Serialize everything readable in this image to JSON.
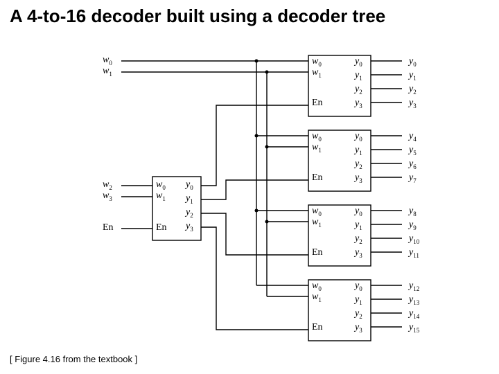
{
  "title": "A 4-to-16 decoder built using a decoder tree",
  "caption": "[ Figure 4.16 from the textbook ]",
  "ext_in_top1": "w",
  "ext_in_top1_sub": "0",
  "ext_in_top2": "w",
  "ext_in_top2_sub": "1",
  "ext_in_bot1": "w",
  "ext_in_bot1_sub": "2",
  "ext_in_bot2": "w",
  "ext_in_bot2_sub": "3",
  "ext_en": "En",
  "left_dec": {
    "w0": "w",
    "w0s": "0",
    "w1": "w",
    "w1s": "1",
    "en": "En",
    "y0": "y",
    "y0s": "0",
    "y1": "y",
    "y1s": "1",
    "y2": "y",
    "y2s": "2",
    "y3": "y",
    "y3s": "3"
  },
  "right_decs": [
    {
      "w0": "w",
      "w0s": "0",
      "w1": "w",
      "w1s": "1",
      "en": "En",
      "iy0": "y",
      "iy0s": "0",
      "iy1": "y",
      "iy1s": "1",
      "iy2": "y",
      "iy2s": "2",
      "iy3": "y",
      "iy3s": "3",
      "oy0": "y",
      "oy0s": "0",
      "oy1": "y",
      "oy1s": "1",
      "oy2": "y",
      "oy2s": "2",
      "oy3": "y",
      "oy3s": "3"
    },
    {
      "w0": "w",
      "w0s": "0",
      "w1": "w",
      "w1s": "1",
      "en": "En",
      "iy0": "y",
      "iy0s": "0",
      "iy1": "y",
      "iy1s": "1",
      "iy2": "y",
      "iy2s": "2",
      "iy3": "y",
      "iy3s": "3",
      "oy0": "y",
      "oy0s": "4",
      "oy1": "y",
      "oy1s": "5",
      "oy2": "y",
      "oy2s": "6",
      "oy3": "y",
      "oy3s": "7"
    },
    {
      "w0": "w",
      "w0s": "0",
      "w1": "w",
      "w1s": "1",
      "en": "En",
      "iy0": "y",
      "iy0s": "0",
      "iy1": "y",
      "iy1s": "1",
      "iy2": "y",
      "iy2s": "2",
      "iy3": "y",
      "iy3s": "3",
      "oy0": "y",
      "oy0s": "8",
      "oy1": "y",
      "oy1s": "9",
      "oy2": "y",
      "oy2s": "10",
      "oy3": "y",
      "oy3s": "11"
    },
    {
      "w0": "w",
      "w0s": "0",
      "w1": "w",
      "w1s": "1",
      "en": "En",
      "iy0": "y",
      "iy0s": "0",
      "iy1": "y",
      "iy1s": "1",
      "iy2": "y",
      "iy2s": "2",
      "iy3": "y",
      "iy3s": "3",
      "oy0": "y",
      "oy0s": "12",
      "oy1": "y",
      "oy1s": "13",
      "oy2": "y",
      "oy2s": "14",
      "oy3": "y",
      "oy3s": "15"
    }
  ]
}
